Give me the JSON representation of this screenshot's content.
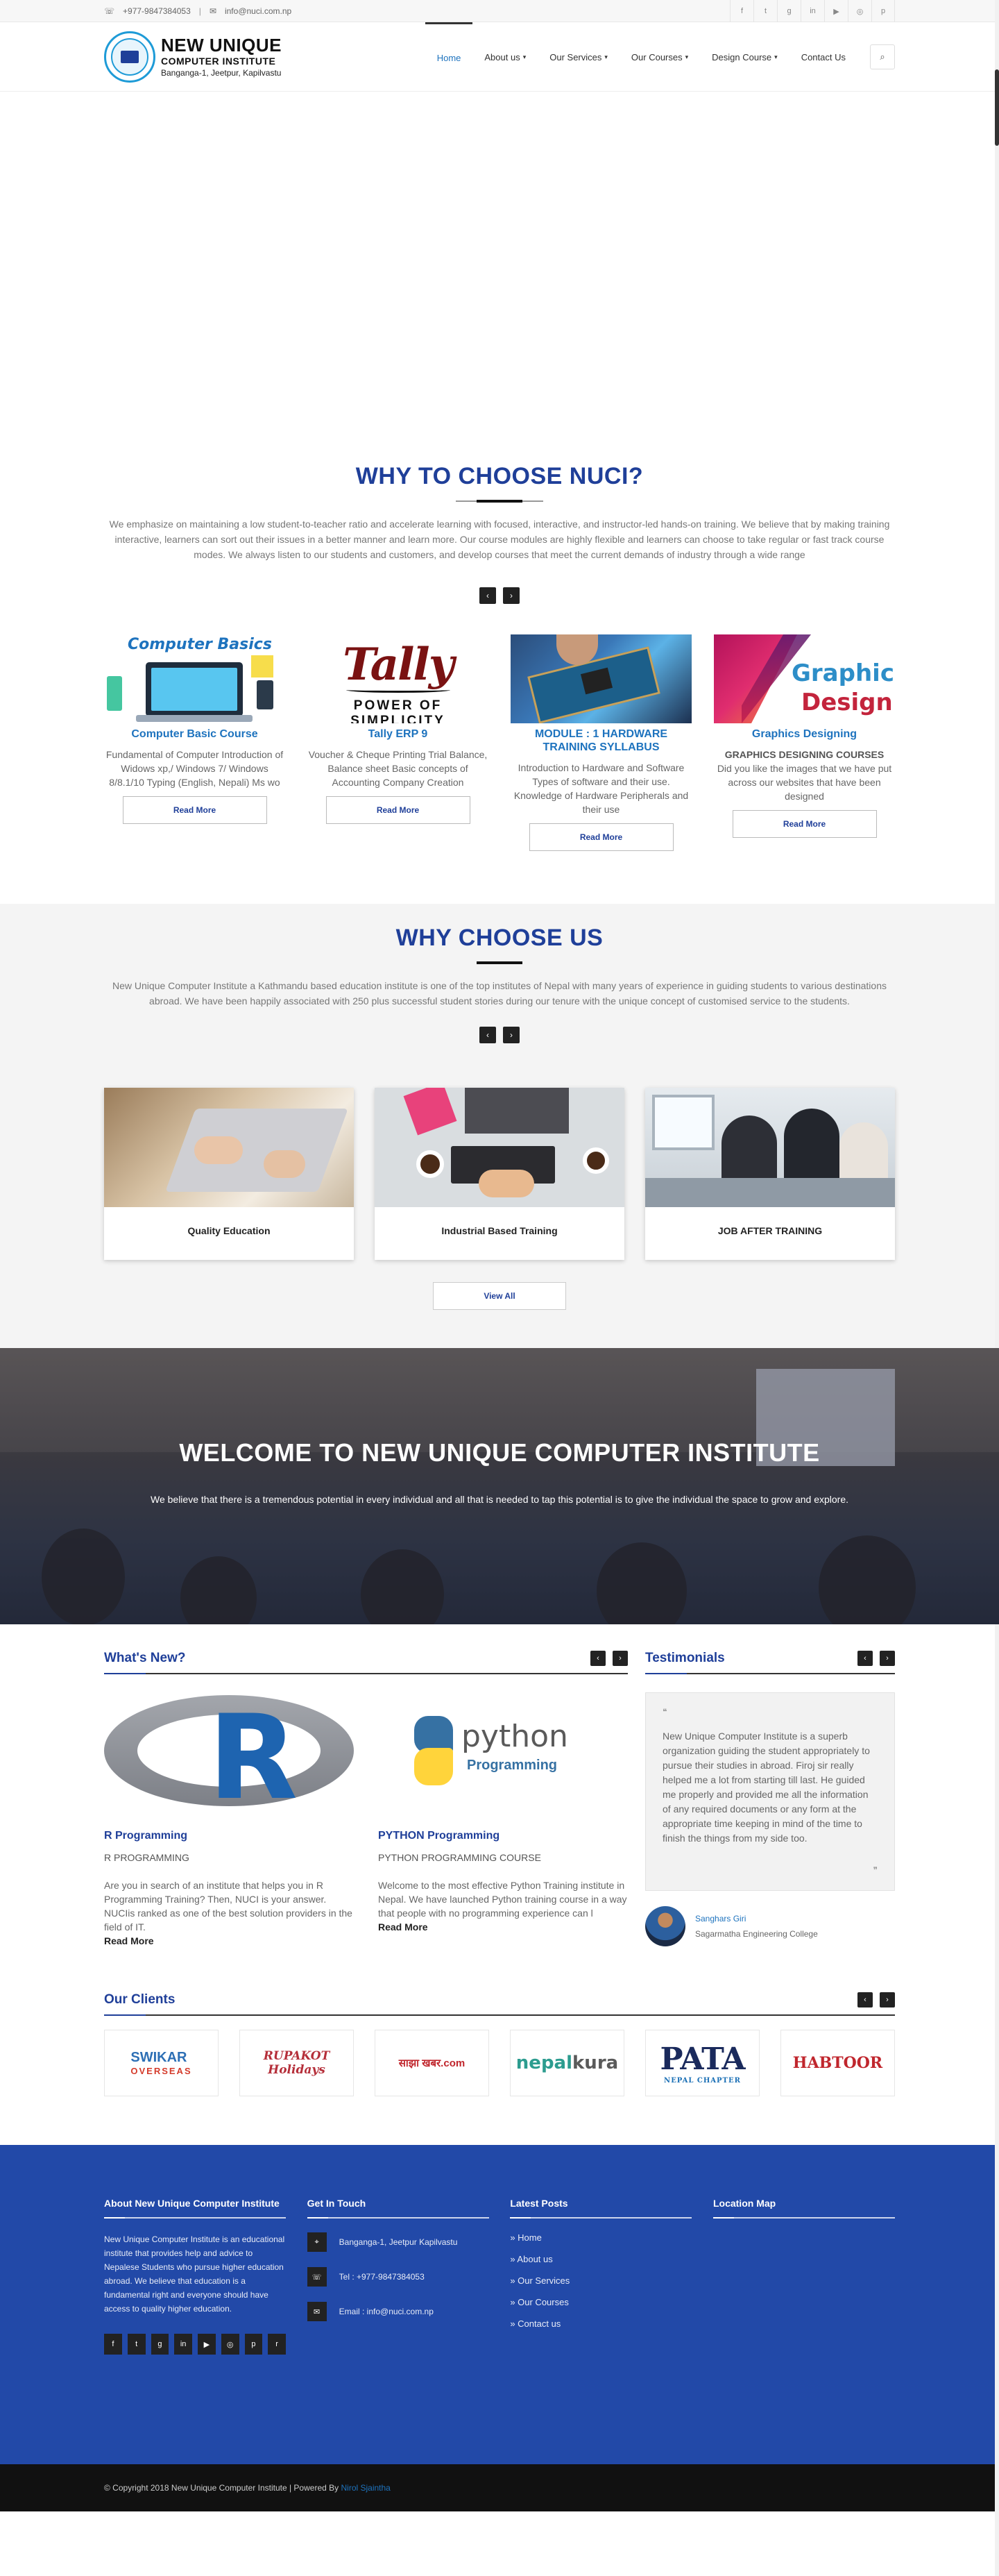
{
  "topbar": {
    "phone": "+977-9847384053",
    "separator": "|",
    "email": "info@nuci.com.np",
    "phone_icon": "phone-icon",
    "email_icon": "envelope-icon",
    "social": [
      "facebook-icon",
      "twitter-icon",
      "google-plus-icon",
      "linkedin-icon",
      "youtube-icon",
      "instagram-icon",
      "pinterest-icon"
    ]
  },
  "logo": {
    "line1": "NEW UNIQUE",
    "line2": "COMPUTER INSTITUTE",
    "line3": "Banganga-1, Jeetpur, Kapilvastu"
  },
  "nav": {
    "items": [
      {
        "label": "Home",
        "active": true
      },
      {
        "label": "About us",
        "dropdown": true
      },
      {
        "label": "Our Services",
        "dropdown": true
      },
      {
        "label": "Our Courses",
        "dropdown": true
      },
      {
        "label": "Design Course",
        "dropdown": true
      },
      {
        "label": "Contact Us"
      }
    ],
    "search_icon": "search-icon"
  },
  "why_nuci": {
    "title": "WHY TO CHOOSE NUCI?",
    "description": "We emphasize on maintaining a low student-to-teacher ratio and accelerate learning with focused, interactive, and instructor-led hands-on training. We believe that by making training interactive, learners can sort out their issues in a better manner and learn more. Our course modules are highly flexible and learners can choose to take regular or fast track course modes. We always listen to our students and customers, and develop courses that meet the current demands of industry through a wide range",
    "courses": [
      {
        "image_title": "Computer Basics",
        "title": "Computer Basic Course",
        "body": "Fundamental of Computer Introduction of Widows xp,/ Windows 7/ Windows 8/8.1/10 Typing (English, Nepali) Ms wo",
        "button": "Read More"
      },
      {
        "image_title": "Tally",
        "image_tag": "POWER OF SIMPLICITY",
        "title": "Tally ERP 9",
        "body": "Voucher & Cheque Printing Trial Balance, Balance sheet Basic concepts of Accounting Company Creation",
        "button": "Read More"
      },
      {
        "title": "MODULE : 1 HARDWARE TRAINING SYLLABUS",
        "body": "Introduction to Hardware and Software Types of software and their use. Knowledge of Hardware Peripherals and their use",
        "button": "Read More"
      },
      {
        "image_title_1": "Graphic",
        "image_title_2": "Design",
        "title": "Graphics Designing",
        "body_strong": "GRAPHICS DESIGNING COURSES",
        "body": "Did you like the images that we have put across our websites that have been designed",
        "button": "Read More"
      }
    ]
  },
  "why_us": {
    "title": "WHY CHOOSE US",
    "description": "New Unique Computer Institute a Kathmandu based education institute is one of the top institutes of Nepal with many years of experience in guiding students to various destinations abroad. We have been happily associated with 250 plus successful student stories during our tenure with the unique concept of customised service to the students.",
    "features": [
      "Quality Education",
      "Industrial Based Training",
      "JOB AFTER TRAINING"
    ],
    "view_all": "View All"
  },
  "welcome": {
    "title": "WELCOME TO NEW UNIQUE COMPUTER INSTITUTE",
    "text": "We believe that there is a tremendous potential in every individual and all that is needed to tap this potential is to give the individual the space to grow and explore."
  },
  "whats_new": {
    "title": "What's New?",
    "posts": [
      {
        "title": "R Programming",
        "subtitle": "R PROGRAMMING",
        "body": "Are you in search of an institute that helps you in R Programming Training? Then, NUCI is your answer. NUCIis ranked as one of the best solution providers in the field of IT.",
        "more": "Read More"
      },
      {
        "title": "PYTHON Programming",
        "subtitle": "PYTHON PROGRAMMING COURSE",
        "body": "Welcome to the most effective Python Training institute in Nepal. We have launched Python training course in a way that people with no programming experience can l",
        "more": "Read More",
        "image_word": "python",
        "image_sub": "Programming"
      }
    ]
  },
  "testimonials": {
    "title": "Testimonials",
    "text": "New Unique Computer Institute is a superb organization guiding the student appropriately to pursue their studies in abroad. Firoj sir really helped me a lot from starting till last. He guided me properly and provided me all the information of any required documents or any form at the appropriate time keeping in mind of the time to finish the things from my side too.",
    "name": "Sanghars Giri",
    "org": "Sagarmatha Engineering College"
  },
  "clients": {
    "title": "Our Clients",
    "items": [
      {
        "name": "SWIKAR",
        "sub": "OVERSEAS"
      },
      {
        "name": "RUPAKOT",
        "sub": "Holidays"
      },
      {
        "name": "साझा खबर.com"
      },
      {
        "name": "nepal",
        "name2": "kura"
      },
      {
        "name": "PATA",
        "sub": "NEPAL CHAPTER"
      },
      {
        "name": "HABTOOR"
      }
    ]
  },
  "footer": {
    "about_title": "About New Unique Computer Institute",
    "about_text": "New Unique Computer Institute is an educational institute that provides help and advice to Nepalese Students who pursue higher education abroad. We believe that education is a fundamental right and everyone should have access to quality higher education.",
    "touch_title": "Get In Touch",
    "address": "Banganga-1, Jeetpur Kapilvastu",
    "tel": "Tel : +977-9847384053",
    "email": "Email : info@nuci.com.np",
    "posts_title": "Latest Posts",
    "links": [
      "» Home",
      "» About us",
      "» Our Services",
      "» Our Courses",
      "» Contact us"
    ],
    "map_title": "Location Map"
  },
  "copyright": {
    "text": "© Copyright 2018 New Unique Computer Institute | Powered By",
    "by": "Nirol Sjaintha"
  }
}
